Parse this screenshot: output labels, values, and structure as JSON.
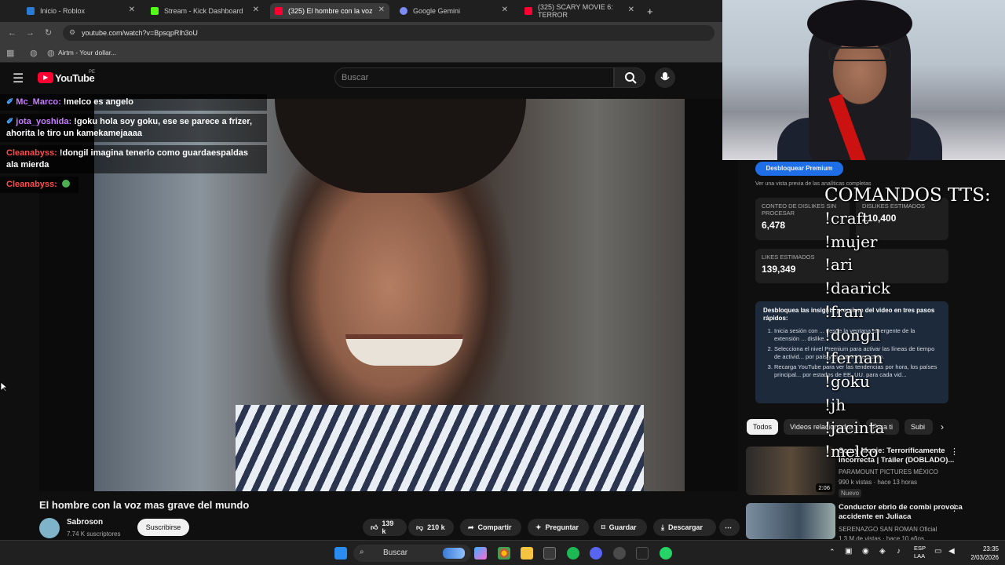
{
  "browser": {
    "tabs": [
      {
        "title": "Inicio - Roblox",
        "fav": "#2a7bd4"
      },
      {
        "title": "Stream - Kick Dashboard",
        "fav": "#53fc18"
      },
      {
        "title": "(325) El hombre con la voz",
        "fav": "#ff0033"
      },
      {
        "title": "Google Gemini",
        "fav": "#7d8bf5"
      },
      {
        "title": "(325) SCARY MOVIE 6: TERROR",
        "fav": "#ff0033"
      }
    ],
    "url": "youtube.com/watch?v=BpsqpRlh3oU",
    "bookmark": "Airtm - Your dollar..."
  },
  "yt": {
    "logo": "YouTube",
    "region": "PE",
    "search_placeholder": "Buscar"
  },
  "chat": [
    {
      "user": "Mc_Marco:",
      "msg": "!melco es angelo",
      "color": "#c77dff"
    },
    {
      "user": "jota_yoshida:",
      "msg": "!goku hola soy goku, ese se parece a frizer, ahorita le tiro un kamekamejaaaa",
      "color": "#c77dff"
    },
    {
      "user": "Cleanabyss:",
      "msg": "!dongil imagina tenerlo como guardaespaldas ala mierda",
      "color": "#ff4d4d"
    },
    {
      "user": "Cleanabyss:",
      "msg": "",
      "color": "#ff4d4d"
    }
  ],
  "video": {
    "title": "El hombre con la voz mas grave del mundo",
    "channel": "Sabroson",
    "subscribers": "7.74 K suscriptores",
    "subscribe": "Suscribirse",
    "likes": "139 k",
    "dislikes": "210 k",
    "share": "Compartir",
    "ask": "Preguntar",
    "save": "Guardar",
    "download": "Descargar"
  },
  "panel": {
    "premium": "Desbloquear Premium",
    "preview_note": "Ver una vista previa de las analíticas completas",
    "dislike_count_label": "CONTEO DE DISLIKES SIN PROCESAR",
    "dislike_count": "6,478",
    "est_dislikes_label": "DISLIKES ESTIMADOS",
    "est_dislikes": "210,400",
    "est_likes_label": "LIKES ESTIMADOS",
    "est_likes": "139,349",
    "unlock_title": "Desbloquea las insights premium del video en tres pasos rápidos:",
    "steps": [
      "Inicia sesión con ... desde la ventana emergente de la extensión ... dislike.",
      "Selecciona el nivel Premium para activar las líneas de tiempo de activid... por país y el mapa interactivo.",
      "Recarga YouTube para ver las tendencias por hora, los países principal... por estados de EE. UU. para cada vid..."
    ]
  },
  "tts": {
    "header": "COMANDOS TTS:",
    "commands": [
      "!craft",
      "!mujer",
      "!ari",
      "!daarick",
      "!fran",
      "!dongil",
      "!fernan",
      "!goku",
      "!jh",
      "!jacinta",
      "!melco"
    ]
  },
  "chips": [
    "Todos",
    "Videos relacionados",
    "Para ti",
    "Subi"
  ],
  "related": [
    {
      "title": "Scary Movie: Terroríficamente Incorrecta | Tráiler (DOBLADO)...",
      "channel": "PARAMOUNT PICTURES MÉXICO",
      "meta": "990 k vistas · hace 13 horas",
      "badge": "Nuevo",
      "duration": "2:06"
    },
    {
      "title": "Conductor ebrio de combi provoca accidente en Juliaca",
      "channel": "SERENAZGO SAN ROMAN Oficial",
      "meta": "1.3 M de vistas · hace 10 años"
    }
  ],
  "taskbar": {
    "search": "Buscar",
    "lang1": "ESP",
    "lang2": "LAA",
    "time": "23:35",
    "date": "2/03/2026"
  }
}
